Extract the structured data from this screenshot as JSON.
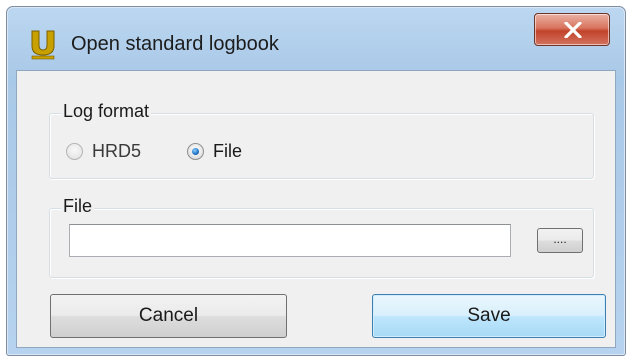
{
  "window": {
    "title": "Open standard logbook",
    "app_icon": "u-logbook-app-icon",
    "close_icon": "close-icon"
  },
  "log_format": {
    "label": "Log format",
    "options": [
      {
        "label": "HRD5",
        "selected": false
      },
      {
        "label": "File",
        "selected": true
      }
    ]
  },
  "file": {
    "label": "File",
    "value": "",
    "browse_label": "...."
  },
  "buttons": {
    "cancel_label": "Cancel",
    "save_label": "Save"
  },
  "colors": {
    "accent": "#3c7fb1",
    "close_button": "#c2432a",
    "app_icon": "#c8a000"
  }
}
